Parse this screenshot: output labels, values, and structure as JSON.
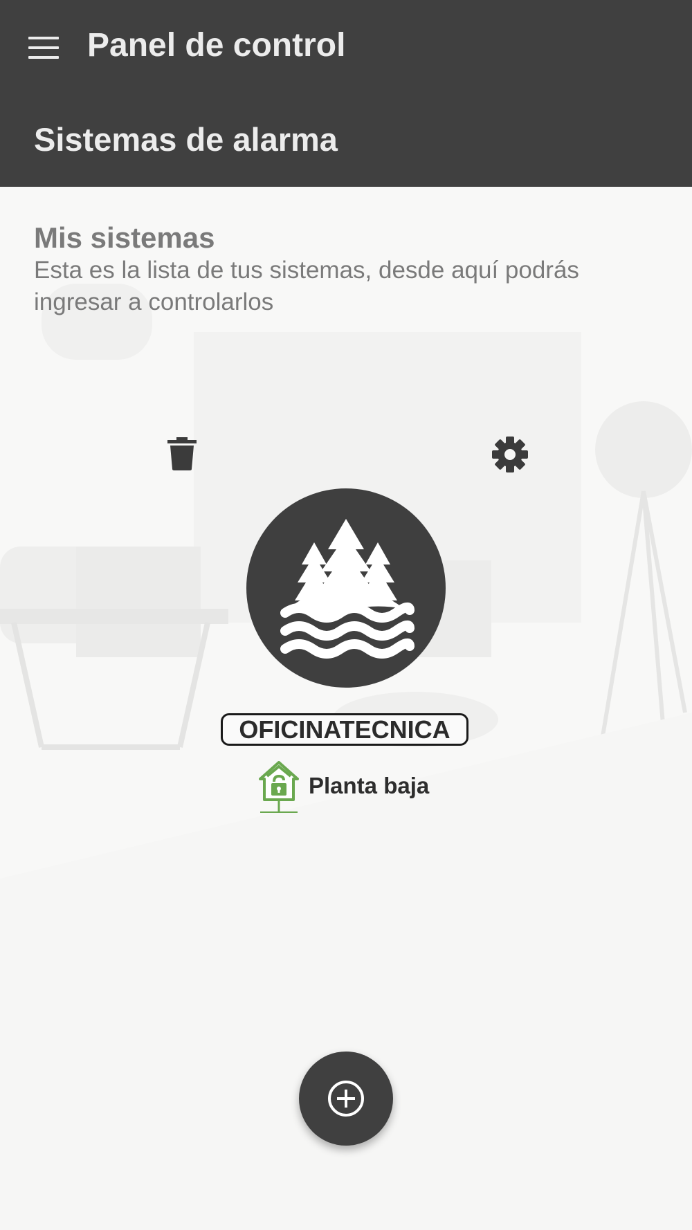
{
  "app_bar": {
    "title": "Panel de control",
    "section": "Sistemas de alarma"
  },
  "intro": {
    "heading": "Mis sistemas",
    "description": "Esta es la lista de tus sistemas, desde aquí podrás ingresar a controlarlos"
  },
  "system": {
    "name": "OFICINATECNICA",
    "avatar_icon": "forest-lake-icon",
    "status_label": "Planta baja",
    "status_icon": "house-unlocked-icon"
  },
  "actions": {
    "delete_icon": "trash-icon",
    "settings_icon": "gear-icon",
    "fab_icon": "add-circle-icon"
  },
  "colors": {
    "app_bar": "#404040",
    "accent_green": "#6aa84f",
    "background": "#f7f7f6"
  }
}
